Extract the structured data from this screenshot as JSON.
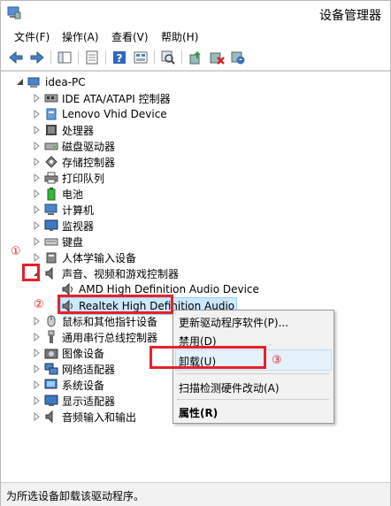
{
  "window": {
    "title": "设备管理器"
  },
  "menu": [
    "文件(F)",
    "操作(A)",
    "查看(V)",
    "帮助(H)"
  ],
  "tree": {
    "root": "idea-PC",
    "categories": [
      "IDE ATA/ATAPI 控制器",
      "Lenovo Vhid Device",
      "处理器",
      "磁盘驱动器",
      "存储控制器",
      "打印队列",
      "电池",
      "计算机",
      "监视器",
      "键盘",
      "人体学输入设备",
      "声音、视频和游戏控制器",
      "鼠标和其他指针设备",
      "通用串行总线控制器",
      "图像设备",
      "网络适配器",
      "系统设备",
      "显示适配器",
      "音频输入和输出"
    ],
    "sound_children": [
      "AMD High Definition Audio Device",
      "Realtek High Definition Audio"
    ]
  },
  "context_menu": {
    "items": [
      "更新驱动程序软件(P)...",
      "禁用(D)",
      "卸载(U)",
      "扫描检测硬件改动(A)",
      "属性(R)"
    ]
  },
  "annotations": [
    "①",
    "②",
    "③"
  ],
  "status": "为所选设备卸载该驱动程序。",
  "colors": {
    "annotation": "#e8202a",
    "selection": "#cde8ff"
  }
}
